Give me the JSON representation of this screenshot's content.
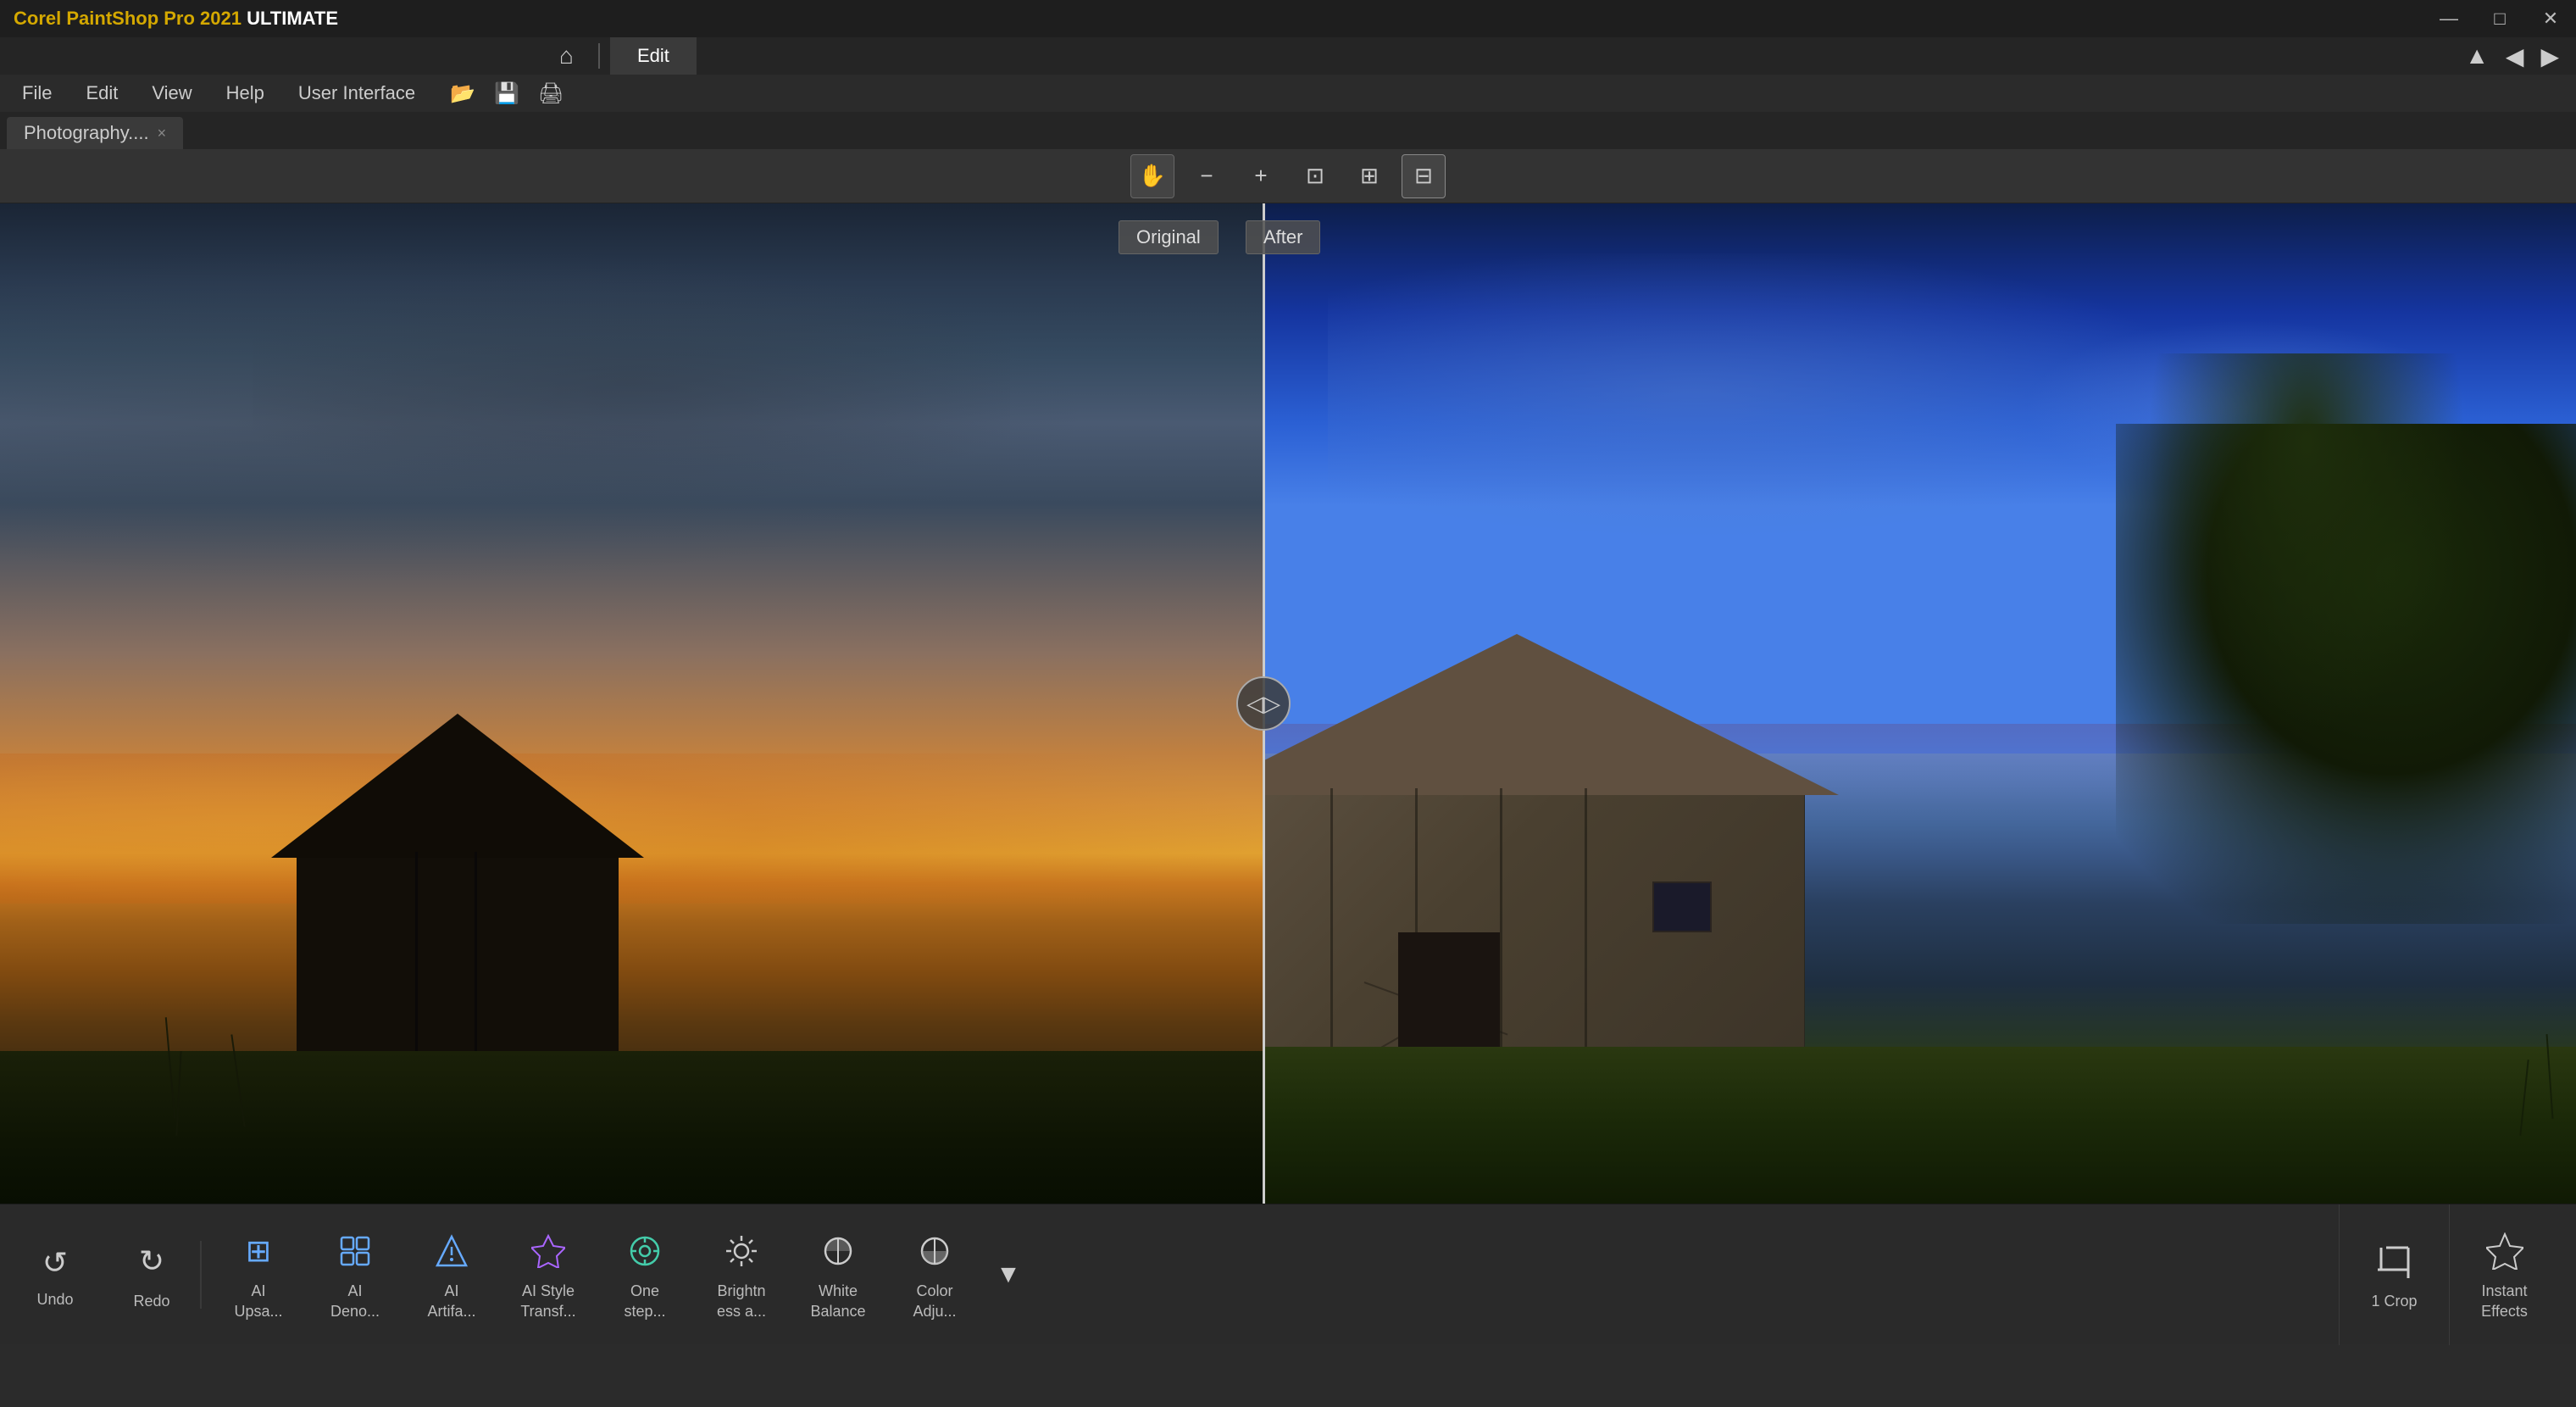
{
  "app": {
    "title_prefix": "Corel ",
    "title_brand": "PaintShop",
    "title_suffix": " Pro 2021 ULTIMATE"
  },
  "titlebar": {
    "title": "Corel PaintShop Pro 2021 ULTIMATE",
    "minimize_label": "—",
    "maximize_label": "□",
    "close_label": "✕"
  },
  "modebar": {
    "home_icon": "⌂",
    "separator": "|",
    "edit_label": "Edit",
    "right_icon1": "▲",
    "right_icon2": "◀",
    "right_icon3": "▶"
  },
  "menubar": {
    "items": [
      "File",
      "Edit",
      "View",
      "Help",
      "User Interface"
    ]
  },
  "toolbar": {
    "icons": [
      "📂",
      "💾",
      "🖨"
    ]
  },
  "view_toolbar": {
    "pan_label": "✋",
    "zoom_out_label": "−",
    "zoom_in_label": "+",
    "fit_label": "⊡",
    "crop_view_label": "⊞",
    "compare_label": "⊟"
  },
  "compare": {
    "original_label": "Original",
    "after_label": "After"
  },
  "tab": {
    "name": "Photography....",
    "close": "×"
  },
  "bottom_toolbar": {
    "undo_label": "Undo",
    "redo_label": "Redo",
    "undo_icon": "↺",
    "redo_icon": "↻",
    "tools": [
      {
        "id": "ai-upsa",
        "icon": "⊞",
        "label": "AI\nUpsa...",
        "color": "ai-icon"
      },
      {
        "id": "ai-deno",
        "icon": "✦",
        "label": "AI\nDeno...",
        "color": "ai-icon"
      },
      {
        "id": "ai-artifa",
        "icon": "◈",
        "label": "AI\nArtifa...",
        "color": "ai-icon"
      },
      {
        "id": "ai-transf",
        "icon": "△",
        "label": "AI Style\nTransf...",
        "color": "ai-icon-purple"
      },
      {
        "id": "one-step",
        "icon": "⊙",
        "label": "One\nstep...",
        "color": "ai-icon-teal"
      },
      {
        "id": "brightn",
        "icon": "✸",
        "label": "Brightn\ness a...",
        "color": ""
      },
      {
        "id": "white-bal",
        "icon": "◑",
        "label": "White\nBalance",
        "color": ""
      },
      {
        "id": "color-adju",
        "icon": "◐",
        "label": "Color\nAdju...",
        "color": ""
      }
    ],
    "more_label": "▼",
    "crop_label": "Crop",
    "crop_icon": "⊡",
    "instant_label": "Instant\nEffects",
    "instant_icon": "✦"
  }
}
